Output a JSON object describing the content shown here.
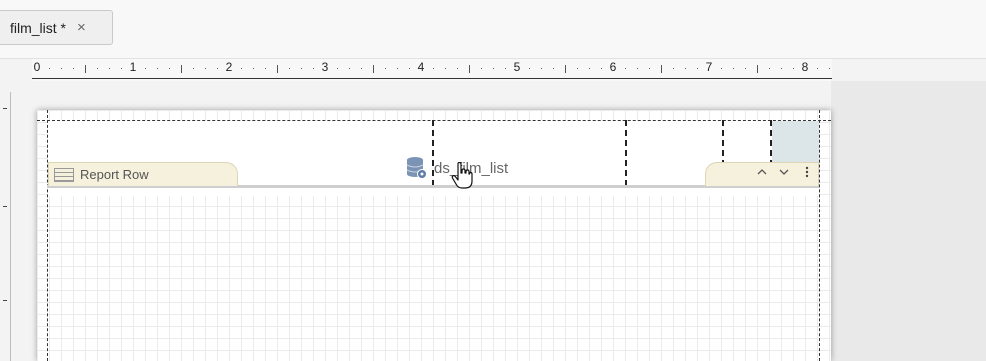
{
  "tabs": [
    {
      "label": "film_list *",
      "close_label": "×"
    }
  ],
  "ruler": {
    "labels": [
      "0",
      "1",
      "2",
      "3",
      "4",
      "5",
      "6",
      "7",
      "8"
    ]
  },
  "report": {
    "row_band_label": "Report Row",
    "datasource_label": "ds_film_list",
    "controls": {
      "move_up": "^",
      "move_down": "v",
      "more": "⋮"
    }
  },
  "colors": {
    "band_tab": "#f5f1dd",
    "selected_cell": "#dce5e8",
    "datasource_icon": "#7b93b5"
  },
  "icons": [
    "report-row-icon",
    "database-icon",
    "hand-cursor-icon",
    "close-icon",
    "chevron-up-icon",
    "chevron-down-icon",
    "more-vertical-icon"
  ]
}
